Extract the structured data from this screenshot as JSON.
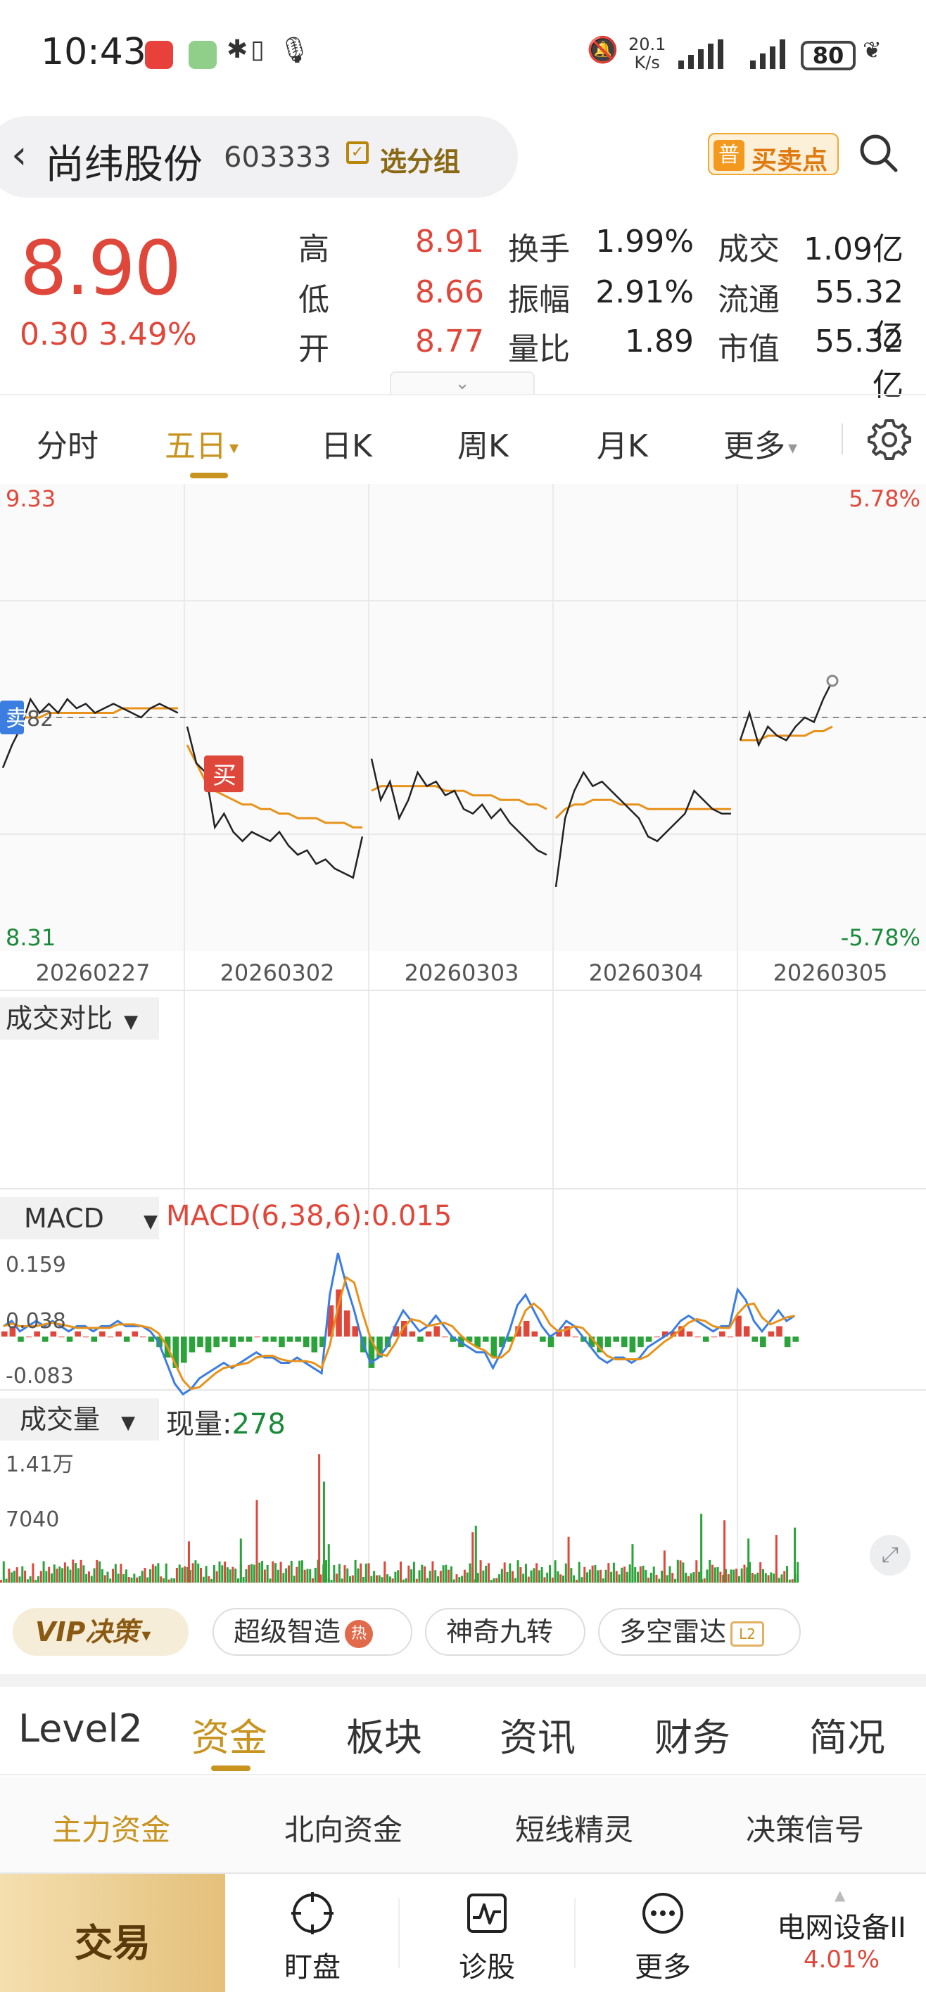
{
  "status_bar": {
    "time": "10:43",
    "net_speed_value": "20.1",
    "net_speed_unit": "K/s",
    "battery": "80",
    "icons": [
      "red-app-icon",
      "green-app-icon",
      "bluetooth-icon",
      "vibrate-icon",
      "mic-icon",
      "mute-icon",
      "signal-icon",
      "signal-icon",
      "battery-icon",
      "leaf-icon"
    ]
  },
  "header": {
    "stock_name": "尚纬股份",
    "stock_code": "603333",
    "group_label": "选分组",
    "signal_badge": "普",
    "signal_label": "买卖点",
    "icons": {
      "back": "back-chevron-icon",
      "search": "search-icon",
      "group": "checkbox-icon"
    }
  },
  "quote": {
    "price": "8.90",
    "change": "0.30 3.49%",
    "stats": [
      {
        "label": "高",
        "value": "8.91",
        "color": "#e0473b"
      },
      {
        "label": "低",
        "value": "8.66",
        "color": "#e0473b"
      },
      {
        "label": "开",
        "value": "8.77",
        "color": "#e0473b"
      },
      {
        "label": "换手",
        "value": "1.99%",
        "color": "#222222"
      },
      {
        "label": "振幅",
        "value": "2.91%",
        "color": "#222222"
      },
      {
        "label": "量比",
        "value": "1.89",
        "color": "#222222"
      },
      {
        "label": "成交",
        "value": "1.09亿",
        "color": "#222222"
      },
      {
        "label": "流通",
        "value": "55.32亿",
        "color": "#222222"
      },
      {
        "label": "市值",
        "value": "55.32亿",
        "color": "#222222"
      }
    ],
    "expand_icon": "chevron-down-icon"
  },
  "period_tabs": {
    "items": [
      "分时",
      "五日",
      "日K",
      "周K",
      "月K",
      "更多"
    ],
    "active": "五日",
    "dropdown_marker": "▾",
    "settings_icon": "gear-icon"
  },
  "chart_data": {
    "type": "line",
    "title": "",
    "x_labels": [
      "20260227",
      "20260302",
      "20260303",
      "20260304",
      "20260305"
    ],
    "y_max": 9.33,
    "y_min": 8.31,
    "pct_max": "5.78%",
    "pct_min": "-5.78%",
    "prev_close": 8.82,
    "prev_close_label": "82",
    "y_max_label": "9.33",
    "y_min_label": "8.31",
    "buy_marker": "买",
    "sell_marker": "卖",
    "days": [
      {
        "date": "20260227",
        "price": [
          8.71,
          8.76,
          8.8,
          8.86,
          8.83,
          8.85,
          8.83,
          8.86,
          8.84,
          8.85,
          8.83,
          8.84,
          8.85,
          8.84,
          8.83,
          8.82,
          8.84,
          8.85,
          8.84,
          8.83
        ],
        "avg": [
          8.8,
          8.81,
          8.82,
          8.82,
          8.82,
          8.83,
          8.83,
          8.83,
          8.83,
          8.83,
          8.83,
          8.83,
          8.83,
          8.84,
          8.84,
          8.84,
          8.84,
          8.84,
          8.84,
          8.84
        ]
      },
      {
        "date": "20260302",
        "price": [
          8.8,
          8.72,
          8.7,
          8.58,
          8.61,
          8.57,
          8.55,
          8.57,
          8.56,
          8.55,
          8.57,
          8.54,
          8.52,
          8.53,
          8.5,
          8.51,
          8.49,
          8.48,
          8.47,
          8.56
        ],
        "avg": [
          8.76,
          8.72,
          8.68,
          8.66,
          8.65,
          8.64,
          8.63,
          8.63,
          8.62,
          8.62,
          8.61,
          8.61,
          8.6,
          8.6,
          8.6,
          8.59,
          8.59,
          8.59,
          8.58,
          8.58
        ]
      },
      {
        "date": "20260303",
        "price": [
          8.73,
          8.64,
          8.68,
          8.6,
          8.64,
          8.7,
          8.67,
          8.68,
          8.65,
          8.66,
          8.62,
          8.61,
          8.63,
          8.6,
          8.62,
          8.59,
          8.57,
          8.55,
          8.53,
          8.52
        ],
        "avg": [
          8.66,
          8.67,
          8.67,
          8.67,
          8.67,
          8.67,
          8.67,
          8.67,
          8.66,
          8.66,
          8.66,
          8.65,
          8.65,
          8.65,
          8.64,
          8.64,
          8.64,
          8.63,
          8.63,
          8.62
        ]
      },
      {
        "date": "20260304",
        "price": [
          8.45,
          8.6,
          8.66,
          8.7,
          8.67,
          8.68,
          8.66,
          8.64,
          8.62,
          8.6,
          8.56,
          8.55,
          8.57,
          8.59,
          8.61,
          8.66,
          8.64,
          8.62,
          8.61,
          8.61
        ],
        "avg": [
          8.6,
          8.62,
          8.63,
          8.63,
          8.64,
          8.64,
          8.64,
          8.63,
          8.63,
          8.63,
          8.62,
          8.62,
          8.62,
          8.62,
          8.62,
          8.62,
          8.62,
          8.62,
          8.62,
          8.62
        ]
      },
      {
        "date": "20260305",
        "price": [
          8.77,
          8.83,
          8.76,
          8.8,
          8.78,
          8.77,
          8.8,
          8.82,
          8.81,
          8.86,
          8.9
        ],
        "avg": [
          8.77,
          8.77,
          8.77,
          8.78,
          8.78,
          8.78,
          8.78,
          8.78,
          8.79,
          8.79,
          8.8
        ]
      }
    ],
    "macd_hist": [
      0.01,
      0.02,
      -0.01,
      0.0,
      0.01,
      -0.01,
      0.01,
      0.0,
      -0.01,
      0.01,
      0.0,
      -0.01,
      0.01,
      0.0,
      0.01,
      -0.01,
      0.01,
      0.0,
      -0.01,
      -0.02,
      -0.04,
      -0.06,
      -0.05,
      -0.03,
      -0.02,
      -0.03,
      -0.02,
      -0.01,
      -0.02,
      -0.01,
      -0.01,
      0.0,
      -0.01,
      -0.01,
      -0.02,
      -0.01,
      -0.01,
      -0.02,
      -0.03,
      -0.02,
      0.06,
      0.09,
      0.05,
      0.02,
      -0.03,
      -0.06,
      -0.04,
      -0.02,
      0.02,
      0.03,
      0.01,
      -0.01,
      0.01,
      0.02,
      0.0,
      -0.01,
      -0.02,
      -0.01,
      -0.02,
      -0.01,
      -0.04,
      -0.02,
      -0.01,
      0.02,
      0.03,
      0.01,
      -0.01,
      -0.02,
      0.01,
      0.02,
      0.0,
      -0.01,
      -0.02,
      -0.03,
      -0.02,
      -0.01,
      -0.02,
      -0.03,
      -0.02,
      -0.01,
      0.0,
      0.01,
      0.01,
      0.02,
      0.01,
      0.0,
      -0.01,
      0.0,
      0.01,
      0.0,
      0.04,
      0.02,
      -0.01,
      -0.02,
      0.01,
      0.02,
      -0.02,
      -0.01
    ],
    "macd_dif": [
      0.02,
      0.03,
      0.01,
      0.02,
      0.03,
      0.02,
      0.03,
      0.02,
      0.01,
      0.02,
      0.02,
      0.01,
      0.02,
      0.02,
      0.03,
      0.02,
      0.02,
      0.02,
      0.01,
      -0.01,
      -0.05,
      -0.09,
      -0.11,
      -0.1,
      -0.08,
      -0.07,
      -0.06,
      -0.05,
      -0.06,
      -0.05,
      -0.04,
      -0.03,
      -0.04,
      -0.04,
      -0.05,
      -0.05,
      -0.04,
      -0.05,
      -0.06,
      -0.07,
      0.08,
      0.16,
      0.1,
      0.05,
      -0.01,
      -0.05,
      -0.04,
      -0.02,
      0.02,
      0.05,
      0.03,
      0.01,
      0.02,
      0.04,
      0.02,
      0.0,
      -0.01,
      -0.02,
      -0.03,
      -0.03,
      -0.06,
      -0.03,
      0.01,
      0.06,
      0.08,
      0.05,
      0.02,
      0.0,
      0.01,
      0.03,
      0.02,
      0.0,
      -0.02,
      -0.04,
      -0.05,
      -0.04,
      -0.04,
      -0.05,
      -0.04,
      -0.02,
      -0.01,
      0.0,
      0.01,
      0.03,
      0.04,
      0.03,
      0.02,
      0.01,
      0.02,
      0.02,
      0.09,
      0.07,
      0.03,
      0.01,
      0.03,
      0.05,
      0.03,
      0.04
    ],
    "macd_y_labels": [
      "0.159",
      "0.038",
      "-0.083"
    ],
    "volume_max_label": "1.41万",
    "volume_mid_label": "7040",
    "volume_max": 14100,
    "volume_spikes": [
      {
        "at": 0.32,
        "v": 9000
      },
      {
        "at": 0.41,
        "v": 4200
      },
      {
        "at": 0.235,
        "v": 4500
      },
      {
        "at": 0.3,
        "v": 4800
      },
      {
        "at": 0.398,
        "v": 14000
      },
      {
        "at": 0.404,
        "v": 11000
      },
      {
        "at": 0.59,
        "v": 5500
      },
      {
        "at": 0.594,
        "v": 6200
      },
      {
        "at": 0.71,
        "v": 5000
      },
      {
        "at": 0.79,
        "v": 4200
      },
      {
        "at": 0.83,
        "v": 3500
      },
      {
        "at": 0.876,
        "v": 7500
      },
      {
        "at": 0.905,
        "v": 6800
      },
      {
        "at": 0.935,
        "v": 4800
      },
      {
        "at": 0.97,
        "v": 5200
      },
      {
        "at": 0.993,
        "v": 6000
      }
    ]
  },
  "panels": {
    "compare_label": "成交对比",
    "macd_label": "MACD",
    "macd_readout": "MACD(6,38,6):0.015",
    "volume_label": "成交量",
    "volume_readout_label": "现量:",
    "volume_readout_value": "278",
    "dropdown_marker": "▼",
    "fullscreen_icon": "fullscreen-icon"
  },
  "chips": {
    "vip": "VIP决策",
    "vip_marker": "▾",
    "items": [
      {
        "label": "超级智造",
        "badge": "热"
      },
      {
        "label": "神奇九转",
        "badge": ""
      },
      {
        "label": "多空雷达",
        "badge": "L2"
      }
    ]
  },
  "main_tabs": {
    "items": [
      "Level2",
      "资金",
      "板块",
      "资讯",
      "财务",
      "简况"
    ],
    "active": "资金"
  },
  "sub_tabs": {
    "items": [
      "主力资金",
      "北向资金",
      "短线精灵",
      "决策信号"
    ],
    "active": "主力资金"
  },
  "bottom_bar": {
    "trade": "交易",
    "items": [
      {
        "label": "盯盘",
        "icon": "crosshair-icon"
      },
      {
        "label": "诊股",
        "icon": "pulse-chart-icon"
      },
      {
        "label": "更多",
        "icon": "more-dots-icon"
      }
    ],
    "sector_name": "电网设备II",
    "sector_pct": "4.01%",
    "sector_arrow": "▲"
  },
  "colors": {
    "up": "#e0473b",
    "down": "#1a8a3a",
    "accent": "#c8931f",
    "price_line": "#222222",
    "avg_line": "#e8921a",
    "macd_dif": "#3b7de0",
    "macd_dea": "#e8921a"
  }
}
